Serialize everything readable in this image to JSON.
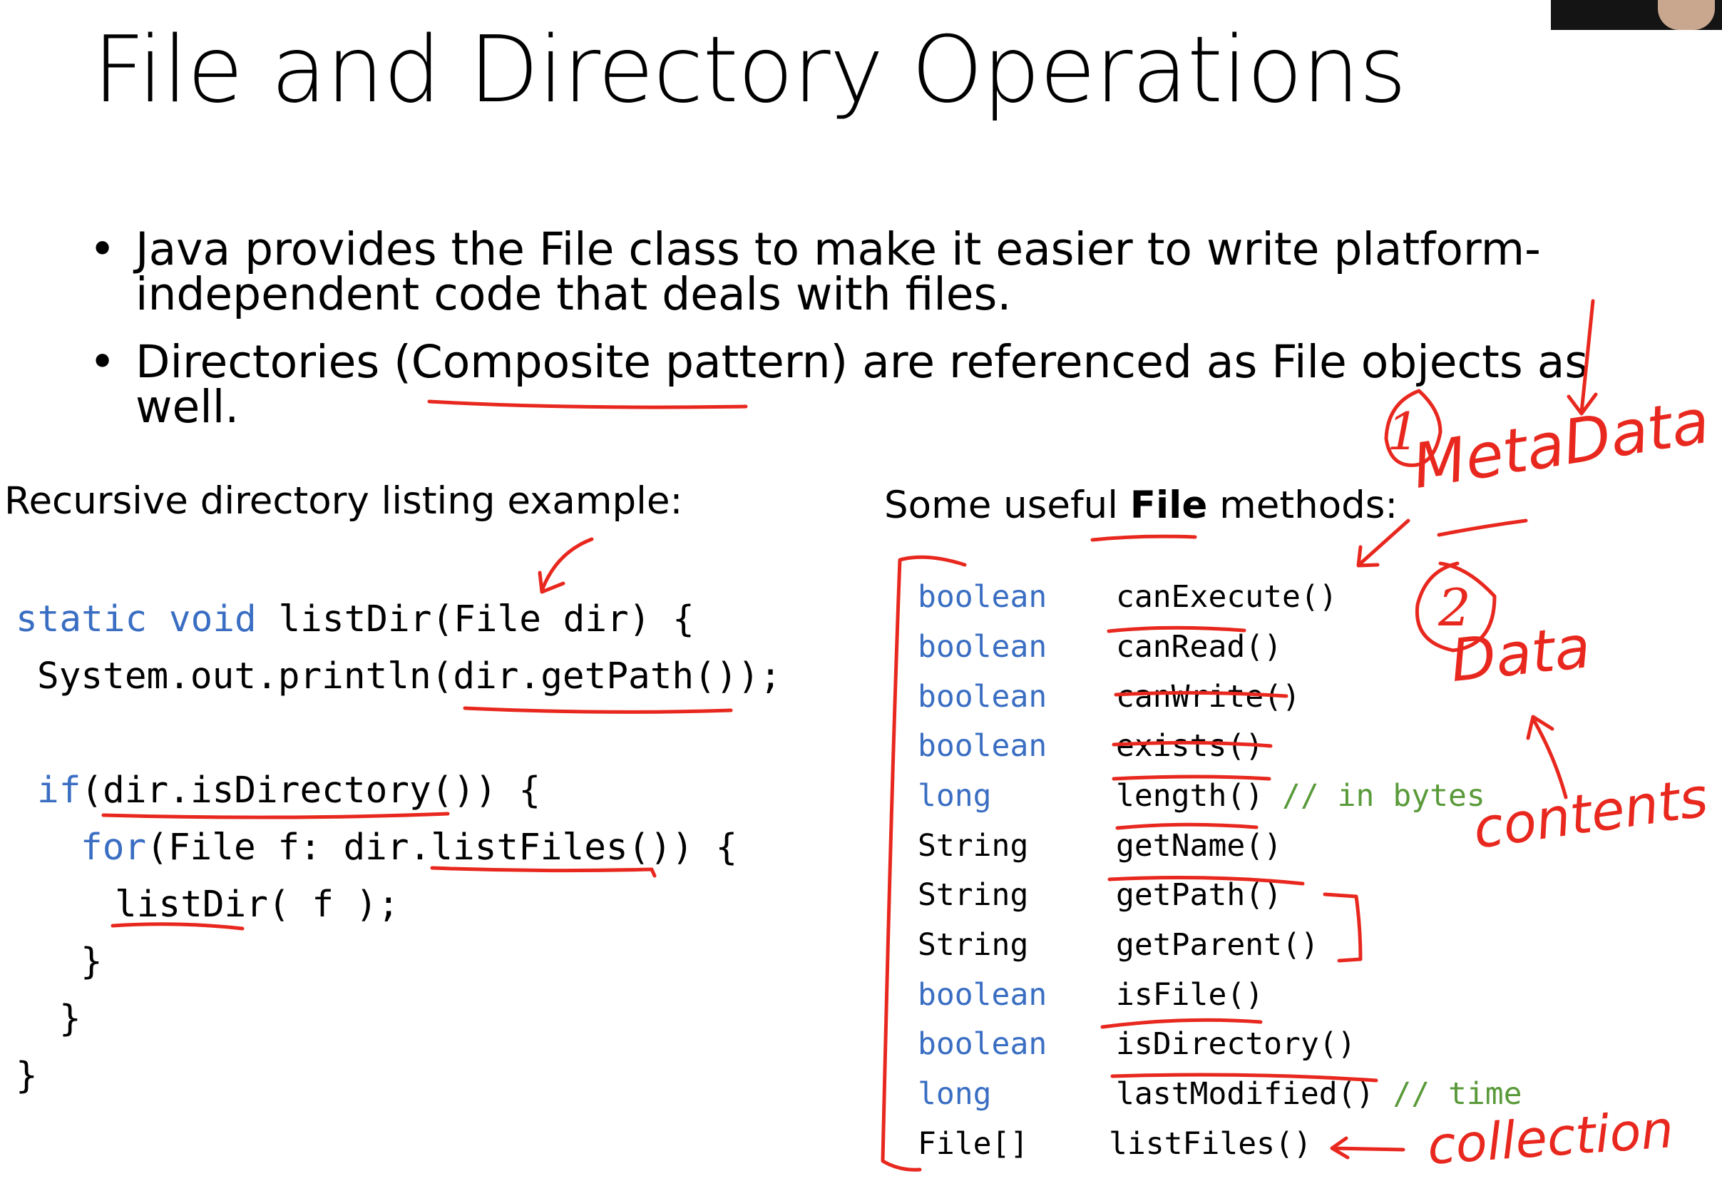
{
  "slide": {
    "title": "File and Directory Operations",
    "bullets": [
      {
        "marker": "•",
        "line1": "Java provides the File class to make it easier to write platform-",
        "line2": "independent code that deals with files."
      },
      {
        "marker": "•",
        "line1": "Directories (Composite pattern) are referenced as File objects as",
        "line2": "well."
      }
    ],
    "left_heading": "Recursive directory listing example:",
    "right_heading_pre": "Some useful ",
    "right_heading_bold": "File",
    "right_heading_post": " methods:"
  },
  "code": {
    "l1_kw": "static void",
    "l1_rest": " listDir(File dir) {",
    "l2": "System.out.println(dir.getPath());",
    "l3_kw": "if",
    "l3_rest": "(dir.isDirectory()) {",
    "l4_kw": "for",
    "l4_rest": "(File f: dir.listFiles()) {",
    "l5": "listDir( f );",
    "l6": "}",
    "l7": "}",
    "l8": "}"
  },
  "methods": [
    {
      "type": "boolean",
      "name": "canExecute()",
      "comment": ""
    },
    {
      "type": "boolean",
      "name": "canRead()",
      "comment": ""
    },
    {
      "type": "boolean",
      "name": "canWrite()",
      "comment": ""
    },
    {
      "type": "boolean",
      "name": "exists()",
      "comment": ""
    },
    {
      "type": "long",
      "name": "length()",
      "comment": " // in bytes"
    },
    {
      "type": "String",
      "name": "getName()",
      "comment": ""
    },
    {
      "type": "String",
      "name": "getPath()",
      "comment": ""
    },
    {
      "type": "String",
      "name": "getParent()",
      "comment": ""
    },
    {
      "type": "boolean",
      "name": "isFile()",
      "comment": ""
    },
    {
      "type": "boolean",
      "name": "isDirectory()",
      "comment": ""
    },
    {
      "type": "long",
      "name": "lastModified()",
      "comment": " // time"
    },
    {
      "type": "File[]",
      "name": "listFiles()",
      "comment": ""
    }
  ],
  "handwriting": {
    "num1": "1",
    "metadata": "MetaData",
    "num2": "2",
    "data": "Data",
    "contents": "contents",
    "collection": "collection"
  },
  "colors": {
    "keyword": "#3a6ec2",
    "comment": "#5a9a3a",
    "ink": "#e8281e"
  }
}
